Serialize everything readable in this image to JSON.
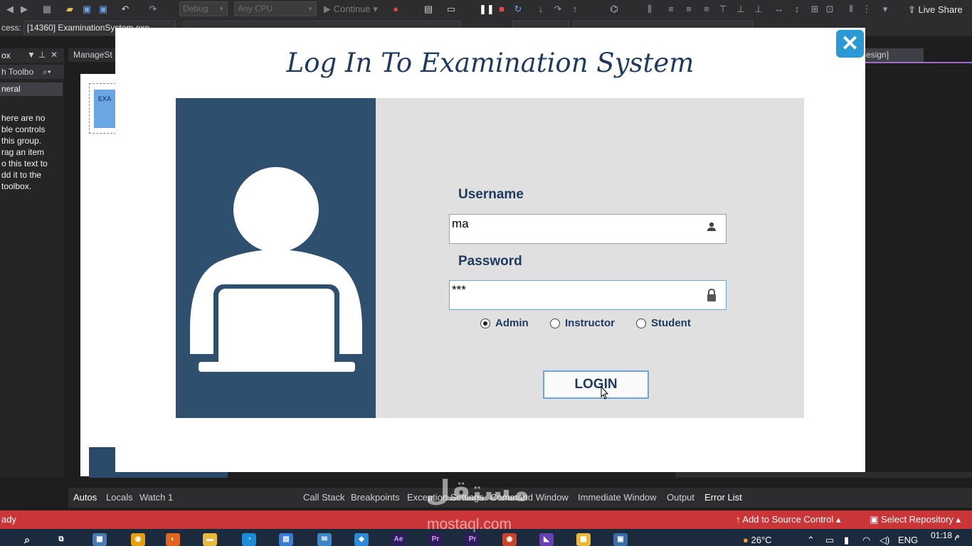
{
  "vs": {
    "toolbar": {
      "config_combo": "Debug",
      "platform_combo": "Any CPU",
      "continue_label": "Continue",
      "live_share_label": "Live Share"
    },
    "process_label": "cess:",
    "process_value": "[14360] ExaminationSystem.exe",
    "toolbox": {
      "title": "ox",
      "search_label": "h Toolbo",
      "group_label": "neral",
      "empty_text": "here are no\nble controls\nthis group.\nrag an item\no this text to\ndd it to the\ntoolbox."
    },
    "doc_tab_left": "ManageSt",
    "doc_tab_right": "esign]",
    "debug_tabs": [
      "Autos",
      "Locals",
      "Watch 1",
      "Call Stack",
      "Breakpoints",
      "Exception Settings",
      "Command Window",
      "Immediate Window",
      "Output",
      "Error List"
    ],
    "status": {
      "left": "ady",
      "source_control": "Add to Source Control",
      "repository": "Select Repository"
    }
  },
  "taskbar": {
    "weather": "26°C",
    "language": "ENG",
    "time": "01:18",
    "time_suffix": "م"
  },
  "watermark": {
    "logo": "مستقل",
    "site": "mostaql.com"
  },
  "login": {
    "title": "Log In To Examination System",
    "close_glyph": "✕",
    "username_label": "Username",
    "username_value": "ma",
    "password_label": "Password",
    "password_value": "***",
    "roles": [
      {
        "label": "Admin",
        "selected": true
      },
      {
        "label": "Instructor",
        "selected": false
      },
      {
        "label": "Student",
        "selected": false
      }
    ],
    "login_button": "LOGIN"
  },
  "colors": {
    "title": "#1f3a5f",
    "left_panel": "#2f4f6f",
    "right_panel": "#e0e0e0",
    "close_button": "#2a9ad6",
    "status_bar": "#ca3538"
  }
}
